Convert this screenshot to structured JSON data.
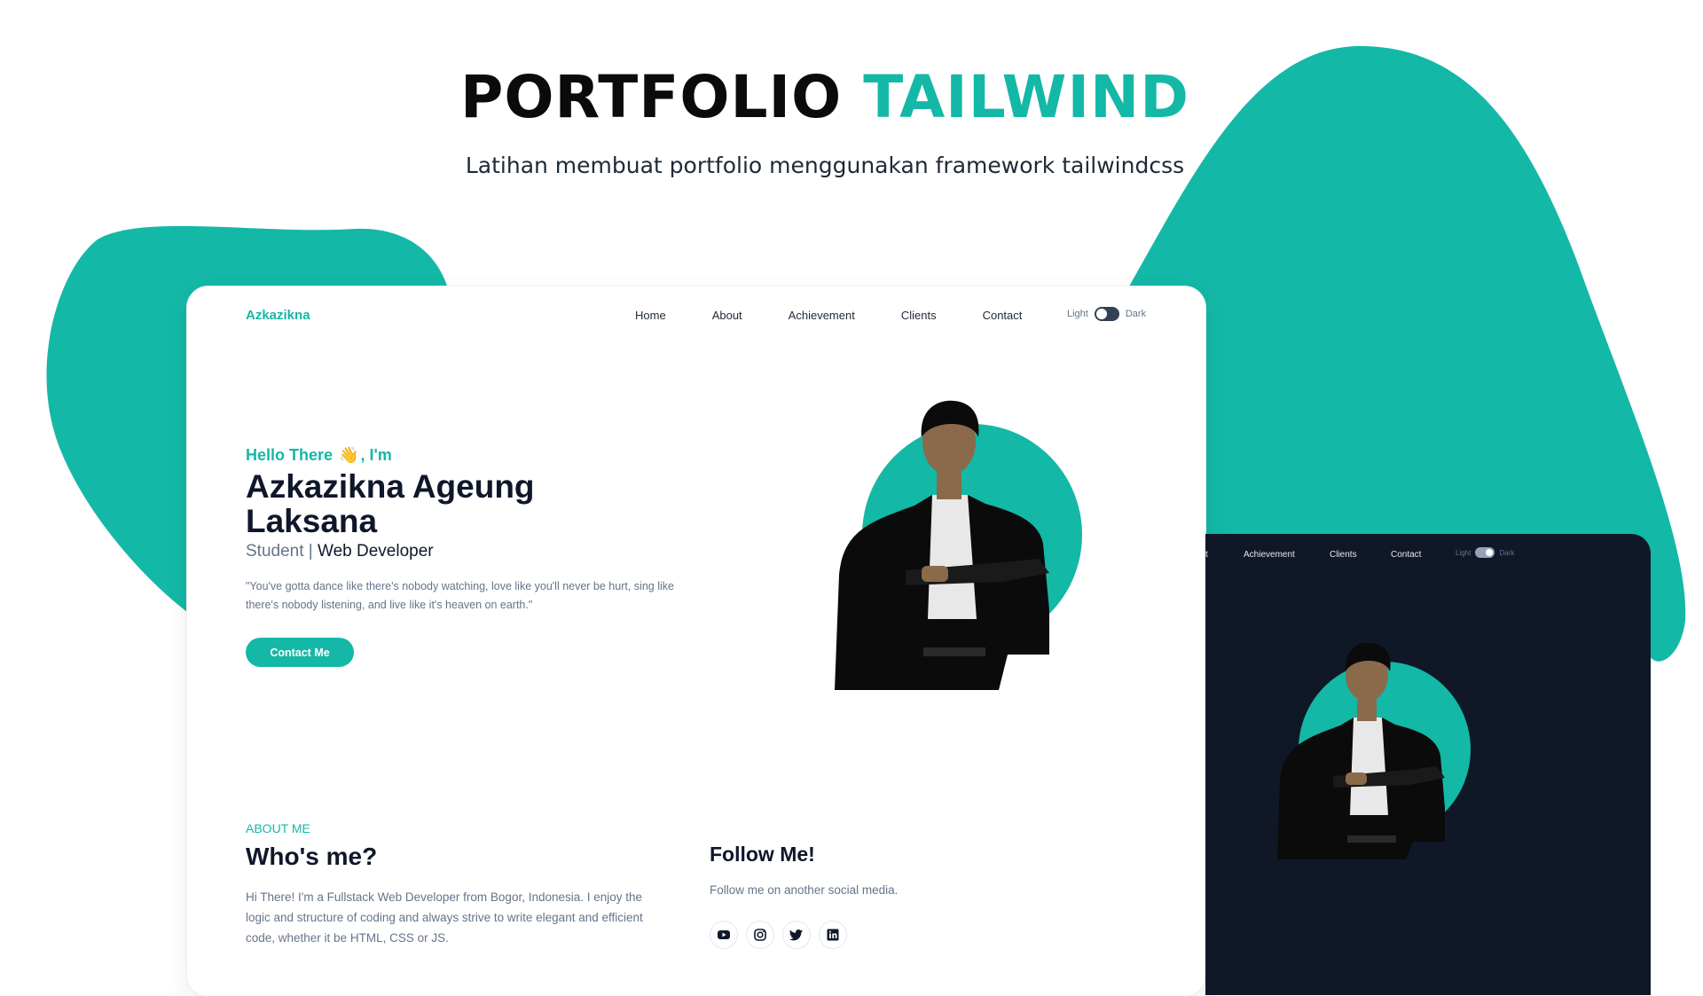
{
  "banner": {
    "title_main": "PORTFOLIO",
    "title_accent": "TAILWIND",
    "subtitle": "Latihan membuat portfolio menggunakan framework tailwindcss"
  },
  "light": {
    "brand": "Azkazikna",
    "nav": [
      "Home",
      "About",
      "Achievement",
      "Clients",
      "Contact"
    ],
    "toggle": {
      "light": "Light",
      "dark": "Dark"
    },
    "hero": {
      "greet_before": "Hello There",
      "greet_after": ", I'm",
      "name": "Azkazikna Ageung Laksana",
      "role_light": "Student |",
      "role_strong": "Web Developer",
      "quote": "\"You've gotta dance like there's nobody watching, love like you'll never be hurt, sing like there's nobody listening, and live like it's heaven on earth.\"",
      "button": "Contact Me"
    },
    "about": {
      "kicker": "ABOUT ME",
      "title": "Who's me?",
      "text": "Hi There! I'm a Fullstack Web Developer from Bogor, Indonesia. I enjoy the logic and structure of coding and always strive to write elegant and efficient code, whether it be HTML, CSS or JS."
    },
    "follow": {
      "title": "Follow Me!",
      "text": "Follow me on another social media.",
      "icons": [
        "youtube-icon",
        "instagram-icon",
        "twitter-icon",
        "linkedin-icon"
      ]
    }
  },
  "dark": {
    "nav_cut": "t",
    "nav": [
      "Achievement",
      "Clients",
      "Contact"
    ],
    "toggle": {
      "light": "Light",
      "dark": "Dark"
    }
  },
  "colors": {
    "accent": "#14b8a6",
    "dark_bg": "#101828",
    "text_dark": "#0f172a",
    "text_muted": "#64748b"
  }
}
